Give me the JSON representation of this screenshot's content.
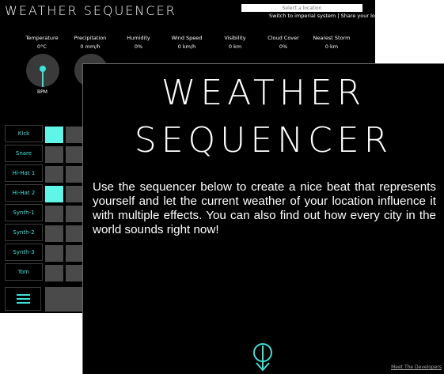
{
  "app": {
    "title": "WEATHER SEQUENCER",
    "location_placeholder": "Select a location",
    "links": {
      "imperial": "Switch to imperial system",
      "separator": " | ",
      "share": "Share your loop"
    },
    "metrics": [
      {
        "name": "Temperature",
        "value": "0°C"
      },
      {
        "name": "Precipitation",
        "value": "0 mm/h"
      },
      {
        "name": "Humidity",
        "value": "0%"
      },
      {
        "name": "Wind Speed",
        "value": "0 km/h"
      },
      {
        "name": "Visibility",
        "value": "0 km"
      },
      {
        "name": "Cloud Cover",
        "value": "0%"
      },
      {
        "name": "Nearest Storm",
        "value": "0 km"
      }
    ],
    "bpm_label": "BPM",
    "tracks": [
      "Kick",
      "Snare",
      "Hi-Hat 1",
      "Hi-Hat 2",
      "Synth-1",
      "Synth-2",
      "Synth-3",
      "Tom"
    ],
    "active_cells_first_column": [
      "Kick",
      "Hi-Hat 2"
    ],
    "accent_color": "#5ff5e8"
  },
  "overlay": {
    "title_line1": "WEATHER",
    "title_line2": "SEQUENCER",
    "intro": "Use the sequencer below to create a nice beat that represents yourself and let the current weather of your location influence it with multiple effects. You can also find out how every city in the world sounds right now!",
    "developers_link": "Meet The Developers",
    "scroll_icon": "scroll-down-icon"
  }
}
